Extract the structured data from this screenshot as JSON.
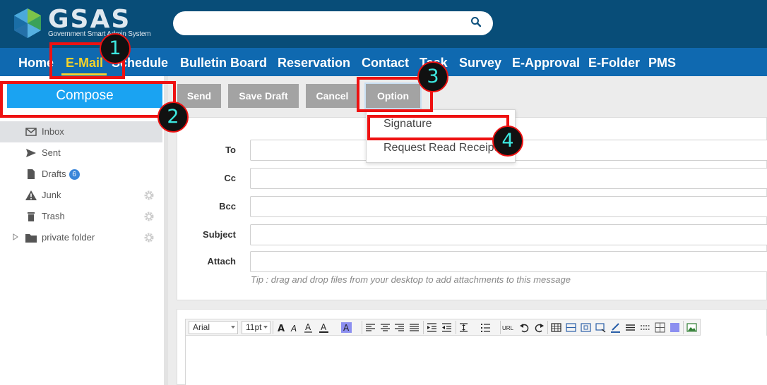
{
  "app": {
    "logo_text": "GSAS",
    "logo_subtitle": "Government Smart Admin System",
    "brand_colors": {
      "header": "#084d78",
      "nav": "#0f69b0",
      "accent": "#f5d22a",
      "compose": "#1aa3f2",
      "annotation": "#ee1111"
    }
  },
  "search": {
    "placeholder": "",
    "icon": "search-icon"
  },
  "nav": {
    "items": [
      "Home",
      "E-Mail",
      "Schedule",
      "Bulletin Board",
      "Reservation",
      "Contact",
      "Task",
      "Survey",
      "E-Approval",
      "E-Folder",
      "PMS"
    ],
    "active": "E-Mail"
  },
  "sidebar": {
    "compose_label": "Compose",
    "folders": [
      {
        "label": "Inbox",
        "icon": "envelope-icon",
        "active": true
      },
      {
        "label": "Sent",
        "icon": "send-icon"
      },
      {
        "label": "Drafts",
        "icon": "document-icon",
        "badge": "6"
      },
      {
        "label": "Junk",
        "icon": "warning-icon",
        "settings": true
      },
      {
        "label": "Trash",
        "icon": "trash-icon",
        "settings": true
      },
      {
        "label": "private folder",
        "icon": "folder-icon",
        "settings": true,
        "expandable": true
      }
    ]
  },
  "toolbar": {
    "send": "Send",
    "save_draft": "Save Draft",
    "cancel": "Cancel",
    "option": "Option"
  },
  "option_menu": {
    "items": [
      "Signature",
      "Request Read Receipt"
    ]
  },
  "form": {
    "to_label": "To",
    "cc_label": "Cc",
    "bcc_label": "Bcc",
    "subject_label": "Subject",
    "attach_label": "Attach",
    "tip": "Tip : drag and drop files from your desktop to add attachments to this message"
  },
  "editor": {
    "font": "Arial",
    "size": "11pt",
    "url_label": "URL"
  },
  "annotations": [
    "1",
    "2",
    "3",
    "4"
  ]
}
